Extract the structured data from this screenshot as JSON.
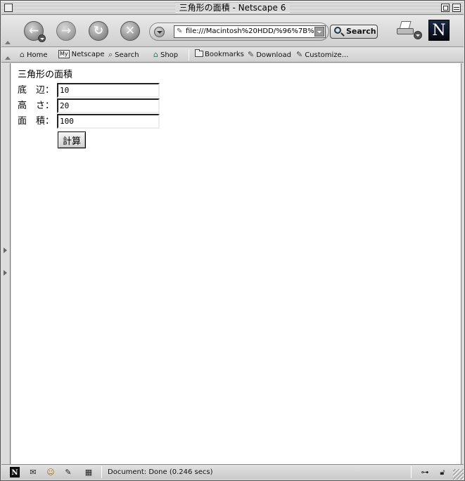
{
  "window": {
    "title": "三角形の面積 - Netscape 6"
  },
  "nav": {
    "back_glyph": "←",
    "forward_glyph": "→",
    "reload_glyph": "↻",
    "stop_glyph": "✕",
    "url": "file:///Macintosh%20HDD/%96%7B%",
    "search_label": "Search",
    "logo_letter": "N"
  },
  "personal_toolbar": {
    "items": [
      {
        "label": "Home",
        "icon": "home-icon"
      },
      {
        "label": "Netscape",
        "icon": "my-netscape-icon",
        "badge": "My"
      },
      {
        "label": "Search",
        "icon": "search-icon"
      },
      {
        "label": "Shop",
        "icon": "shop-icon"
      },
      {
        "label": "Bookmarks",
        "icon": "folder-icon"
      },
      {
        "label": "Download",
        "icon": "bookmark-icon"
      },
      {
        "label": "Customize...",
        "icon": "bookmark-icon"
      }
    ]
  },
  "page": {
    "heading": "三角形の面積",
    "fields": [
      {
        "label": "底　辺：",
        "value": "10"
      },
      {
        "label": "高　さ：",
        "value": "20"
      },
      {
        "label": "面　積：",
        "value": "100"
      }
    ],
    "calc_button": "計算"
  },
  "status": {
    "text": "Document: Done (0.246 secs)",
    "n_badge": "N"
  }
}
